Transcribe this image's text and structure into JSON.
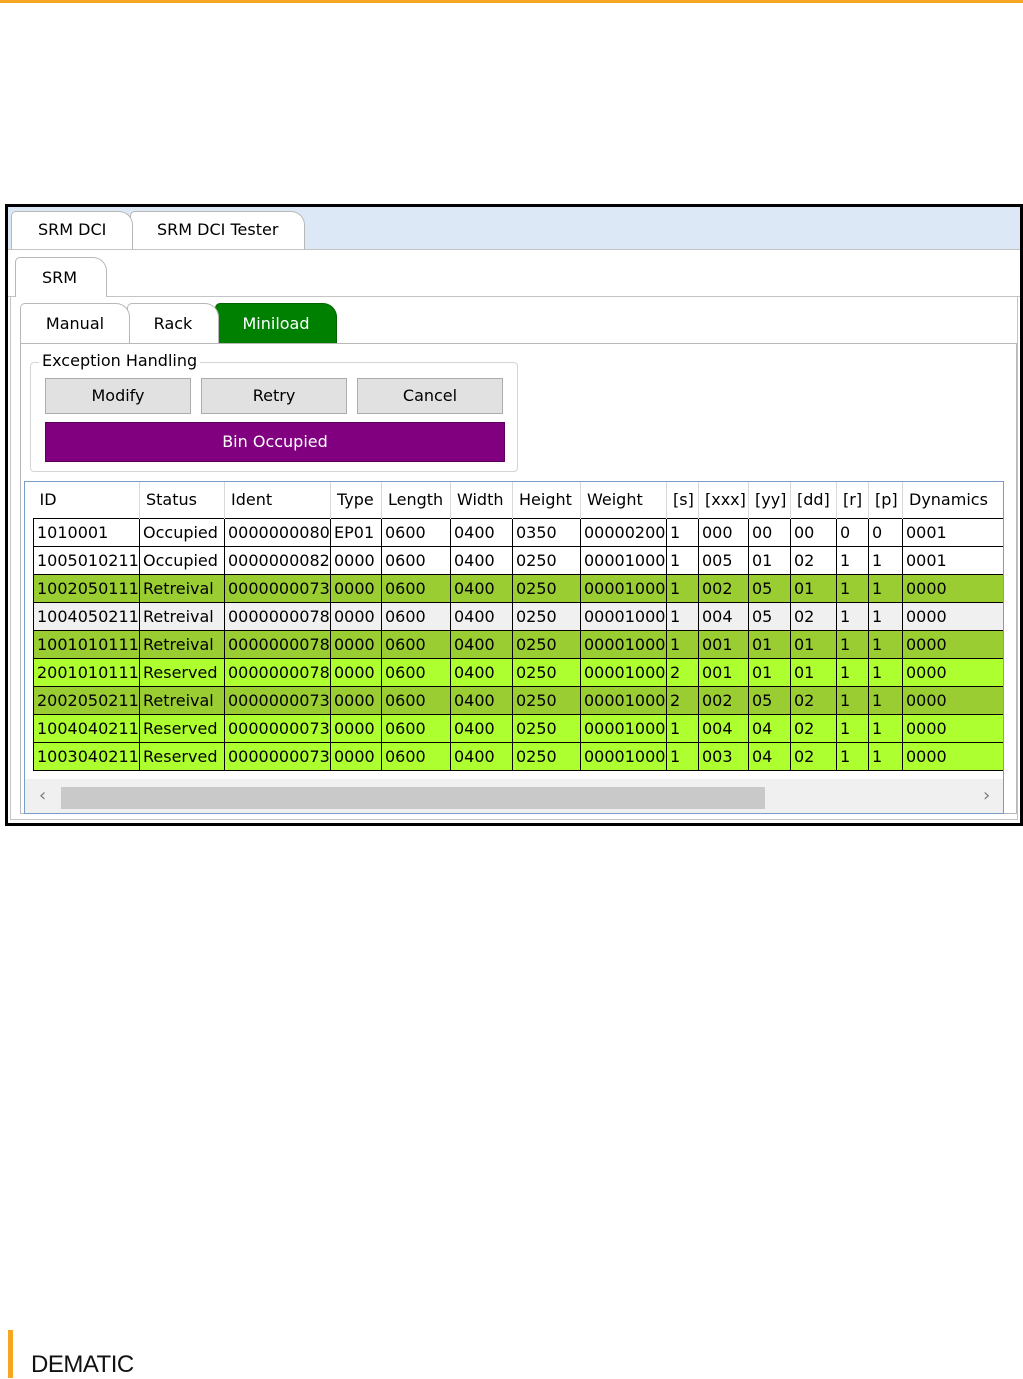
{
  "window_tabs": [
    "SRM DCI",
    "SRM DCI Tester"
  ],
  "module_tab": "SRM",
  "sub_tabs": [
    "Manual",
    "Rack",
    "Miniload"
  ],
  "exception_handling": {
    "title": "Exception Handling",
    "buttons": [
      "Modify",
      "Retry",
      "Cancel"
    ],
    "status": "Bin Occupied",
    "status_color": "#800080"
  },
  "grid": {
    "columns": [
      "ID",
      "Status",
      "Ident",
      "Type",
      "Length",
      "Width",
      "Height",
      "Weight",
      "[s]",
      "[xxx]",
      "[yy]",
      "[dd]",
      "[r]",
      "[p]",
      "Dynamics"
    ],
    "rows": [
      [
        "1010001",
        "Occupied",
        "0000000080",
        "EP01",
        "0600",
        "0400",
        "0350",
        "00000200",
        "1",
        "000",
        "00",
        "00",
        "0",
        "0",
        "0001"
      ],
      [
        "1005010211",
        "Occupied",
        "0000000082",
        "0000",
        "0600",
        "0400",
        "0250",
        "00001000",
        "1",
        "005",
        "01",
        "02",
        "1",
        "1",
        "0001"
      ],
      [
        "1002050111",
        "Retreival",
        "0000000073",
        "0000",
        "0600",
        "0400",
        "0250",
        "00001000",
        "1",
        "002",
        "05",
        "01",
        "1",
        "1",
        "0000"
      ],
      [
        "1004050211",
        "Retreival",
        "0000000078",
        "0000",
        "0600",
        "0400",
        "0250",
        "00001000",
        "1",
        "004",
        "05",
        "02",
        "1",
        "1",
        "0000"
      ],
      [
        "1001010111",
        "Retreival",
        "0000000078",
        "0000",
        "0600",
        "0400",
        "0250",
        "00001000",
        "1",
        "001",
        "01",
        "01",
        "1",
        "1",
        "0000"
      ],
      [
        "2001010111",
        "Reserved",
        "0000000078",
        "0000",
        "0600",
        "0400",
        "0250",
        "00001000",
        "2",
        "001",
        "01",
        "01",
        "1",
        "1",
        "0000"
      ],
      [
        "2002050211",
        "Retreival",
        "0000000073",
        "0000",
        "0600",
        "0400",
        "0250",
        "00001000",
        "2",
        "002",
        "05",
        "02",
        "1",
        "1",
        "0000"
      ],
      [
        "1004040211",
        "Reserved",
        "0000000073",
        "0000",
        "0600",
        "0400",
        "0250",
        "00001000",
        "1",
        "004",
        "04",
        "02",
        "1",
        "1",
        "0000"
      ],
      [
        "1003040211",
        "Reserved",
        "0000000073",
        "0000",
        "0600",
        "0400",
        "0250",
        "00001000",
        "1",
        "003",
        "04",
        "02",
        "1",
        "1",
        "0000"
      ]
    ],
    "row_colors": [
      "#ffffff",
      "#ffffff",
      "#9acd32",
      "#f0f0f0",
      "#9acd32",
      "#adff2f",
      "#9acd32",
      "#adff2f",
      "#adff2f"
    ],
    "scroll_left_icon": "chevron-left-icon",
    "scroll_right_icon": "chevron-right-icon"
  },
  "colors": {
    "active_tab": "#008000",
    "accent": "#f5a623"
  },
  "footer": {
    "brand": "DEMATIC"
  }
}
